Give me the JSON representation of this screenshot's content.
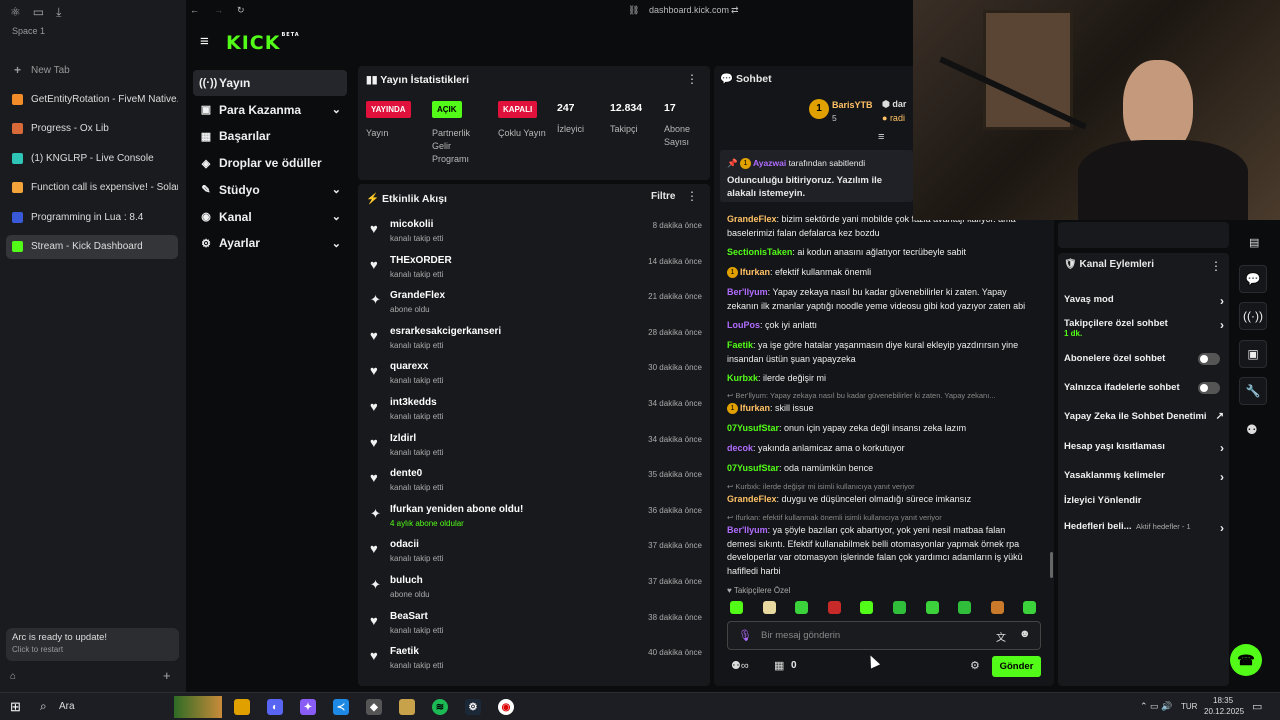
{
  "arc": {
    "space": "Space 1",
    "new_tab": "New Tab",
    "tabs": [
      {
        "label": "GetEntityRotation - FiveM Native...",
        "color": "#f28c28"
      },
      {
        "label": "Progress - Ox Lib",
        "color": "#d86a3a"
      },
      {
        "label": "(1) KNGLRP - Live Console",
        "color": "#2ec4b6"
      },
      {
        "label": "Function call is expensive! - Solar...",
        "color": "#f2a33a"
      },
      {
        "label": "Programming in Lua : 8.4",
        "color": "#3a59d8"
      },
      {
        "label": "Stream - Kick Dashboard",
        "color": "#53fc18"
      }
    ],
    "update_title": "Arc is ready to update!",
    "update_sub": "Click to restart"
  },
  "browser": {
    "url": "dashboard.kick.com"
  },
  "kick": {
    "logo": "KICK",
    "beta": "BETA"
  },
  "nav": [
    {
      "label": "Yayın",
      "icon": "((·))",
      "chevron": false
    },
    {
      "label": "Para Kazanma",
      "icon": "▣",
      "chevron": true
    },
    {
      "label": "Başarılar",
      "icon": "▦",
      "chevron": false
    },
    {
      "label": "Droplar ve ödüller",
      "icon": "◈",
      "chevron": false
    },
    {
      "label": "Stüdyo",
      "icon": "✎",
      "chevron": true
    },
    {
      "label": "Kanal",
      "icon": "◉",
      "chevron": true
    },
    {
      "label": "Ayarlar",
      "icon": "⚙",
      "chevron": true
    }
  ],
  "stats": {
    "title": "Yayın İstatistikleri",
    "badges": [
      {
        "text": "YAYINDA",
        "bg": "#e0113a",
        "fg": "#fff",
        "label": "Yayın"
      },
      {
        "text": "AÇIK",
        "bg": "#53fc18",
        "fg": "#000",
        "label": "Partnerlik Gelir Programı"
      },
      {
        "text": "KAPALI",
        "bg": "#e0113a",
        "fg": "#fff",
        "label": "Çoklu Yayın"
      }
    ],
    "numbers": [
      {
        "value": "247",
        "label": "İzleyici"
      },
      {
        "value": "12.834",
        "label": "Takipçi"
      },
      {
        "value": "17",
        "label": "Abone Sayısı"
      }
    ]
  },
  "activity": {
    "title": "Etkinlik Akışı",
    "filter": "Filtre",
    "items": [
      {
        "name": "micokolii",
        "sub": "kanalı takip etti",
        "time": "8 dakika önce",
        "icon": "heart"
      },
      {
        "name": "THExORDER",
        "sub": "kanalı takip etti",
        "time": "14 dakika önce",
        "icon": "heart"
      },
      {
        "name": "GrandeFlex",
        "sub": "abone oldu",
        "time": "21 dakika önce",
        "icon": "star"
      },
      {
        "name": "esrarkesakcigerkanseri",
        "sub": "kanalı takip etti",
        "time": "28 dakika önce",
        "icon": "heart"
      },
      {
        "name": "quarexx",
        "sub": "kanalı takip etti",
        "time": "30 dakika önce",
        "icon": "heart"
      },
      {
        "name": "int3kedds",
        "sub": "kanalı takip etti",
        "time": "34 dakika önce",
        "icon": "heart"
      },
      {
        "name": "Izldirl",
        "sub": "kanalı takip etti",
        "time": "34 dakika önce",
        "icon": "heart"
      },
      {
        "name": "dente0",
        "sub": "kanalı takip etti",
        "time": "35 dakika önce",
        "icon": "heart"
      },
      {
        "name": "Ifurkan yeniden abone oldu!",
        "sub": "4 aylık abone oldular",
        "time": "36 dakika önce",
        "icon": "star"
      },
      {
        "name": "odacii",
        "sub": "kanalı takip etti",
        "time": "37 dakika önce",
        "icon": "heart"
      },
      {
        "name": "buluch",
        "sub": "abone oldu",
        "time": "37 dakika önce",
        "icon": "star"
      },
      {
        "name": "BeaSart",
        "sub": "kanalı takip etti",
        "time": "38 dakika önce",
        "icon": "heart"
      },
      {
        "name": "Faetik",
        "sub": "kanalı takip etti",
        "time": "40 dakika önce",
        "icon": "heart"
      }
    ]
  },
  "chat": {
    "title": "Sohbet",
    "top_user": "BarisYTB",
    "top_count": "5",
    "top_user2": "dar",
    "top_user3": "radi",
    "pinned_by": "Ayazwai",
    "pinned_label": "tarafından sabitlendi",
    "pinned_text": "Odunculuğu bitiriyoruz. Yazılım ile alakalı istemeyin.",
    "messages": [
      {
        "user": "GrandeFlex",
        "color": "#ffc266",
        "text": "bizim sektörde yani mobilde çok fazla avantajı kalıyor. ama baselerimizi falan defalarca kez bozdu"
      },
      {
        "user": "SectionisTaken",
        "color": "#53fc18",
        "text": "ai kodun anasını ağlatıyor tecrübeyle sabit"
      },
      {
        "user": "Ifurkan",
        "color": "#ffc266",
        "text": "efektif kullanmak önemli",
        "badge": "1"
      },
      {
        "user": "Ber'llyum",
        "color": "#b06cff",
        "text": "Yapay zekaya nasıl bu kadar güvenebilirler ki zaten. Yapay zekanın ilk zmanlar yaptığı noodle yeme videosu gibi kod yazıyor zaten abi"
      },
      {
        "user": "LouPos",
        "color": "#b06cff",
        "text": "çok iyi anlattı"
      },
      {
        "user": "Faetik",
        "color": "#53fc18",
        "text": "ya işe göre hatalar yaşanmasın diye kural ekleyip yazdırırsın yine insandan üstün şuan yapayzeka"
      },
      {
        "user": "Kurbxk",
        "color": "#53fc18",
        "text": "ilerde değişir mi"
      },
      {
        "reply": "Ber'llyum: Yapay zekaya nasıl bu kadar güvenebilirler ki zaten. Yapay zekanı..."
      },
      {
        "user": "Ifurkan",
        "color": "#ffc266",
        "text": "skill issue",
        "badge": "1"
      },
      {
        "user": "07YusufStar",
        "color": "#53fc18",
        "text": "onun için yapay zeka değil insansı zeka lazım"
      },
      {
        "user": "decok",
        "color": "#b06cff",
        "text": "yakında anlamicaz ama o korkutuyor"
      },
      {
        "user": "07YusufStar",
        "color": "#53fc18",
        "text": "oda namümkün bence"
      },
      {
        "reply": "Kurbxk: ilerde değişir mi isimli kullanıcıya yanıt veriyor"
      },
      {
        "user": "GrandeFlex",
        "color": "#ffc266",
        "text": "duygu ve düşünceleri olmadığı sürece imkansız"
      },
      {
        "reply": "Ifurkan: efektif kullanmak önemli isimli kullanıcıya yanıt veriyor"
      },
      {
        "user": "Ber'llyum",
        "color": "#b06cff",
        "text": "ya şöyle bazıları çok abartıyor, yok yeni nesil matbaa falan demesi sıkıntı. Efektif kullanabilmek belli otomasyonlar yapmak örnek rpa developerlar var otomasyon işlerinde falan çok yardımcı adamların iş yükü hafifledi harbi"
      }
    ],
    "followers_only": "Takipçilere Özel",
    "placeholder": "Bir mesaj gönderin",
    "count": "0",
    "send": "Gönder"
  },
  "actions": {
    "title": "Kanal Eylemleri",
    "rows": [
      {
        "label": "Yavaş mod",
        "kind": "arrow"
      },
      {
        "label": "Takipçilere özel sohbet",
        "sub": "1 dk.",
        "kind": "arrow"
      },
      {
        "label": "Abonelere özel sohbet",
        "kind": "toggle"
      },
      {
        "label": "Yalnızca ifadelerle sohbet",
        "kind": "toggle"
      },
      {
        "label": "Yapay Zeka ile Sohbet Denetimi",
        "kind": "ext"
      },
      {
        "label": "Hesap yaşı kısıtlaması",
        "kind": "arrow"
      },
      {
        "label": "Yasaklanmış kelimeler",
        "kind": "arrow"
      },
      {
        "label": "İzleyici Yönlendir",
        "kind": "none"
      },
      {
        "label": "Hedefleri beli...",
        "sub": "Aktif hedefler - 1",
        "kind": "arrow"
      }
    ]
  },
  "taskbar": {
    "search": "Ara",
    "lang": "TUR",
    "time": "18:35",
    "date": "20.12.2025"
  }
}
